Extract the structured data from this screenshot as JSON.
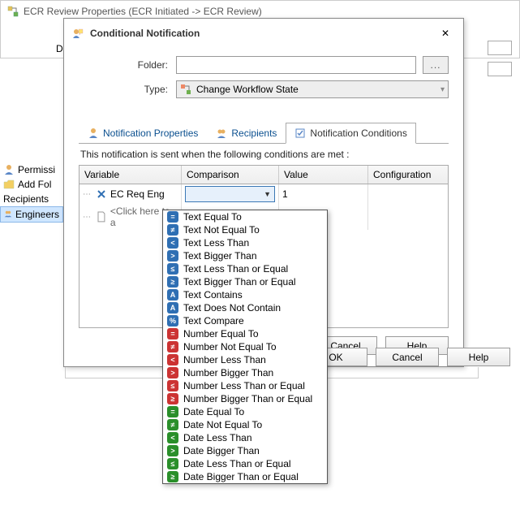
{
  "outer_window_title": "ECR Review Properties (ECR Initiated -> ECR Review)",
  "outer_label_d": "D",
  "sidebar": {
    "permissions": "Permissi",
    "add_folder": "Add Fol",
    "recipients": "Recipients",
    "engineers": "Engineers"
  },
  "dialog": {
    "title": "Conditional Notification",
    "folder_label": "Folder:",
    "folder_value": "",
    "browse_label": "...",
    "type_label": "Type:",
    "type_value": "Change Workflow State",
    "tabs": {
      "props": "Notification Properties",
      "recipients": "Recipients",
      "conditions": "Notification Conditions"
    },
    "hint": "This notification is sent when the following conditions are met :",
    "columns": {
      "variable": "Variable",
      "comparison": "Comparison",
      "value": "Value",
      "configuration": "Configuration"
    },
    "row1": {
      "variable": "EC Req Eng",
      "value": "1"
    },
    "click_hint": "<Click here to a",
    "buttons": {
      "cancel": "Cancel",
      "help": "Help"
    }
  },
  "dropdown_items": [
    {
      "color": "ic-blue",
      "glyph": "=",
      "label": "Text Equal To"
    },
    {
      "color": "ic-blue",
      "glyph": "≠",
      "label": "Text Not Equal To"
    },
    {
      "color": "ic-blue",
      "glyph": "<",
      "label": "Text Less Than"
    },
    {
      "color": "ic-blue",
      "glyph": ">",
      "label": "Text Bigger Than"
    },
    {
      "color": "ic-blue",
      "glyph": "≤",
      "label": "Text Less Than or Equal"
    },
    {
      "color": "ic-blue",
      "glyph": "≥",
      "label": "Text Bigger Than or Equal"
    },
    {
      "color": "ic-blue",
      "glyph": "A",
      "label": "Text Contains"
    },
    {
      "color": "ic-blue",
      "glyph": "A",
      "label": "Text Does Not Contain"
    },
    {
      "color": "ic-blue",
      "glyph": "%",
      "label": "Text Compare"
    },
    {
      "color": "ic-red",
      "glyph": "=",
      "label": "Number Equal To"
    },
    {
      "color": "ic-red",
      "glyph": "≠",
      "label": "Number Not Equal To"
    },
    {
      "color": "ic-red",
      "glyph": "<",
      "label": "Number Less Than"
    },
    {
      "color": "ic-red",
      "glyph": ">",
      "label": "Number Bigger Than"
    },
    {
      "color": "ic-red",
      "glyph": "≤",
      "label": "Number Less Than or Equal"
    },
    {
      "color": "ic-red",
      "glyph": "≥",
      "label": "Number Bigger Than or Equal"
    },
    {
      "color": "ic-green",
      "glyph": "=",
      "label": "Date Equal To"
    },
    {
      "color": "ic-green",
      "glyph": "≠",
      "label": "Date Not Equal To"
    },
    {
      "color": "ic-green",
      "glyph": "<",
      "label": "Date Less Than"
    },
    {
      "color": "ic-green",
      "glyph": ">",
      "label": "Date Bigger Than"
    },
    {
      "color": "ic-green",
      "glyph": "≤",
      "label": "Date Less Than or Equal"
    },
    {
      "color": "ic-green",
      "glyph": "≥",
      "label": "Date Bigger Than or Equal"
    }
  ],
  "outer_buttons": {
    "ok": "OK",
    "cancel": "Cancel",
    "help": "Help"
  }
}
